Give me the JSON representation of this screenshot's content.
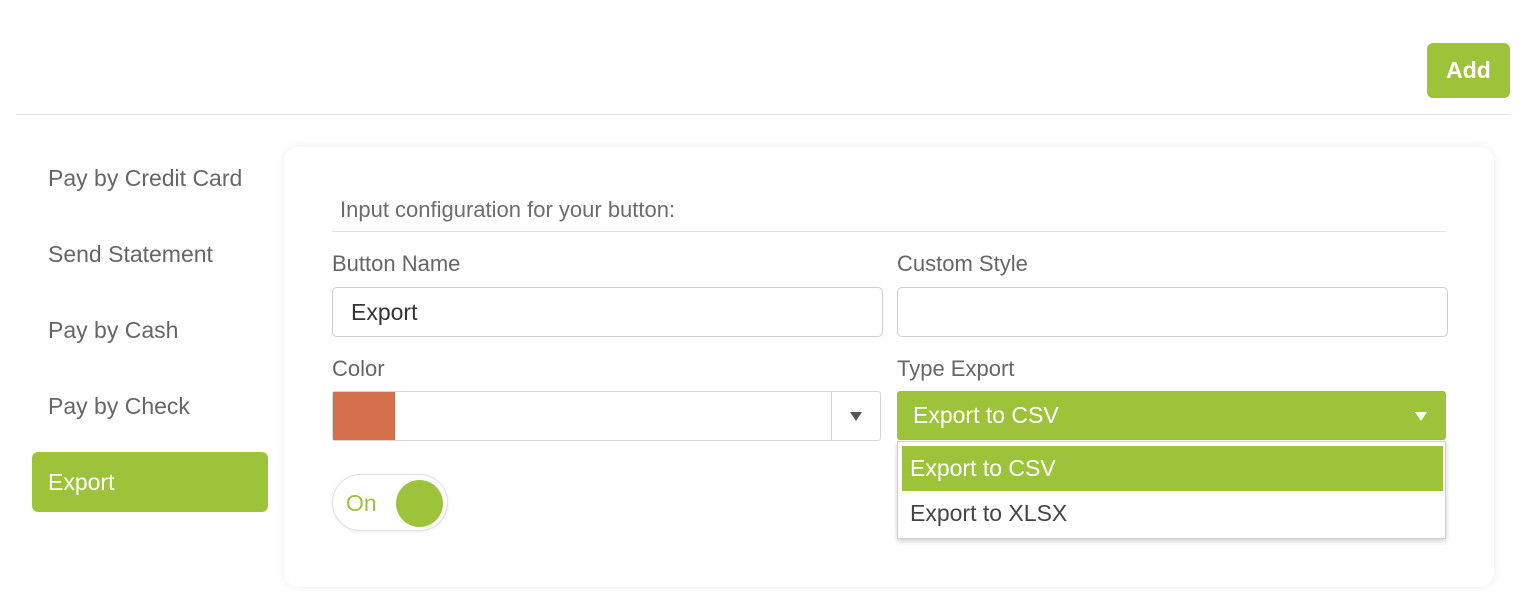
{
  "header": {
    "add_label": "Add"
  },
  "sidebar": {
    "items": [
      {
        "label": "Pay by Credit Card"
      },
      {
        "label": "Send Statement"
      },
      {
        "label": "Pay by Cash"
      },
      {
        "label": "Pay by Check"
      },
      {
        "label": "Export",
        "active": true
      }
    ]
  },
  "form": {
    "intro": "Input configuration for your button:",
    "button_name": {
      "label": "Button Name",
      "value": "Export"
    },
    "custom_style": {
      "label": "Custom Style",
      "value": ""
    },
    "color": {
      "label": "Color",
      "swatch": "#d4704b"
    },
    "type_export": {
      "label": "Type Export",
      "selected": "Export to CSV",
      "options": [
        "Export to CSV",
        "Export to XLSX"
      ]
    },
    "toggle": {
      "label": "On",
      "state": "on"
    }
  },
  "colors": {
    "accent": "#9dc33b"
  }
}
